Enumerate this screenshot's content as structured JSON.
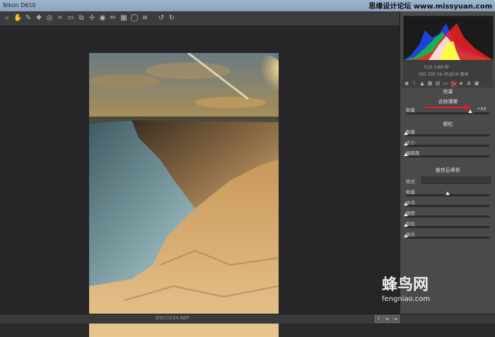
{
  "window": {
    "title": "Nikon D610",
    "watermark": "思缘设计论坛 www.missyuan.com"
  },
  "toolbar": {
    "tools": [
      {
        "name": "zoom-icon",
        "glyph": "⌕"
      },
      {
        "name": "hand-icon",
        "glyph": "✋"
      },
      {
        "name": "white-balance-icon",
        "glyph": "✎"
      },
      {
        "name": "color-sampler-icon",
        "glyph": "✚"
      },
      {
        "name": "target-adjust-icon",
        "glyph": "◎"
      },
      {
        "name": "crop-icon",
        "glyph": "⌗"
      },
      {
        "name": "straighten-icon",
        "glyph": "▭"
      },
      {
        "name": "transform-icon",
        "glyph": "⧉"
      },
      {
        "name": "spot-removal-icon",
        "glyph": "✢"
      },
      {
        "name": "red-eye-icon",
        "glyph": "◉"
      },
      {
        "name": "brush-icon",
        "glyph": "✏"
      },
      {
        "name": "graduated-filter-icon",
        "glyph": "▦"
      },
      {
        "name": "radial-filter-icon",
        "glyph": "◯"
      },
      {
        "name": "prefs-icon",
        "glyph": "≡"
      },
      {
        "name": "rotate-ccw-icon",
        "glyph": "↺"
      },
      {
        "name": "rotate-cw-icon",
        "glyph": "↻"
      }
    ]
  },
  "info": {
    "line1": "f/16   1/80 秒",
    "line2": "ISO 100   16-35@16 毫米"
  },
  "panel": {
    "tabs": [
      "basic",
      "tone-curve",
      "detail",
      "hsl",
      "split-toning",
      "lens",
      "effects",
      "camera-cal",
      "presets",
      "snapshots"
    ],
    "section_title": "效果",
    "dehaze_group": "去除薄雾",
    "dehaze_label": "数量",
    "dehaze_value": "+69",
    "grain_group": "颗粒",
    "grain_sliders": [
      {
        "label": "数量",
        "value": 0.0
      },
      {
        "label": "大小",
        "value": 0.0
      },
      {
        "label": "粗糙度",
        "value": 0.0
      }
    ],
    "vignette_group": "裁剪后晕影",
    "style_label": "样式",
    "vignette_sliders": [
      {
        "label": "数量",
        "value": 0.5
      },
      {
        "label": "中点",
        "value": 0.0
      },
      {
        "label": "圆度",
        "value": 0.0
      },
      {
        "label": "羽化",
        "value": 0.0
      },
      {
        "label": "高光",
        "value": 0.0
      }
    ]
  },
  "status": {
    "filename": "DSC0234.NEF"
  },
  "logo": {
    "main": "蜂鸟网",
    "sub": "fengniao.com"
  }
}
